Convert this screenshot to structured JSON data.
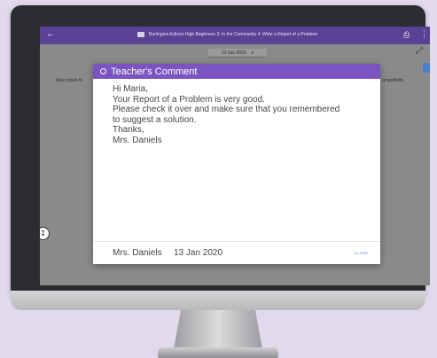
{
  "app_bar": {
    "back_icon": "arrow-left-icon",
    "folder_icon": "folder-icon",
    "title": "Burlington-Edison High Beginners 3: In the Community 4: Write a Report of a Problem",
    "print_icon": "print-icon",
    "more_icon": "more-vertical-icon"
  },
  "date_select": {
    "value": "13 Jan 2020",
    "chevron": "▾"
  },
  "background": {
    "left_text": "New report fo",
    "right_text": "ur portfolio."
  },
  "dialog": {
    "title": "Teacher's Comment",
    "header_color": "#7b54c2",
    "body_lines": [
      "Hi Maria,",
      "Your Report of a Problem is very good.",
      "Please check it over and make sure that you remembered",
      "to suggest a solution.",
      "Thanks,",
      "Mrs. Daniels"
    ],
    "footer": {
      "author": "Mrs. Daniels",
      "date": "13 Jan 2020",
      "close_label": "CLOSE"
    }
  },
  "colors": {
    "page_background": "#e2d9ec",
    "app_bar": "#5b4196",
    "accent_link": "#3b7ad8"
  }
}
